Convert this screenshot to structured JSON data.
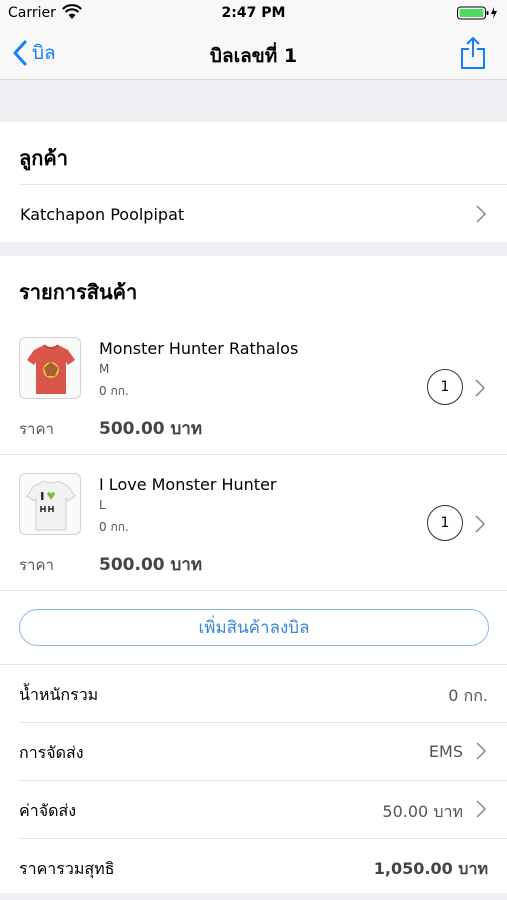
{
  "status_bar": {
    "carrier": "Carrier",
    "time": "2:47 PM"
  },
  "nav": {
    "back_label": "บิล",
    "title": "บิลเลขที่ 1",
    "accent_color": "#157efb"
  },
  "customer": {
    "section_title": "ลูกค้า",
    "name": "Katchapon Poolpipat"
  },
  "items": {
    "section_title": "รายการสินค้า",
    "list": [
      {
        "name": "Monster Hunter Rathalos",
        "size": "M",
        "weight": "0 กก.",
        "quantity": "1",
        "price_label": "ราคา",
        "price": "500.00 บาท"
      },
      {
        "name": "I Love Monster Hunter",
        "size": "L",
        "weight": "0 กก.",
        "quantity": "1",
        "price_label": "ราคา",
        "price": "500.00 บาท"
      }
    ],
    "add_button_label": "เพิ่มสินค้าลงบิล"
  },
  "summary": {
    "total_weight_label": "น้ำหนักรวม",
    "total_weight": "0 กก.",
    "shipping_label": "การจัดส่ง",
    "shipping": "EMS",
    "shipping_cost_label": "ค่าจัดส่ง",
    "shipping_cost": "50.00 บาท",
    "net_total_label": "ราคารวมสุทธิ",
    "net_total": "1,050.00 บาท"
  }
}
